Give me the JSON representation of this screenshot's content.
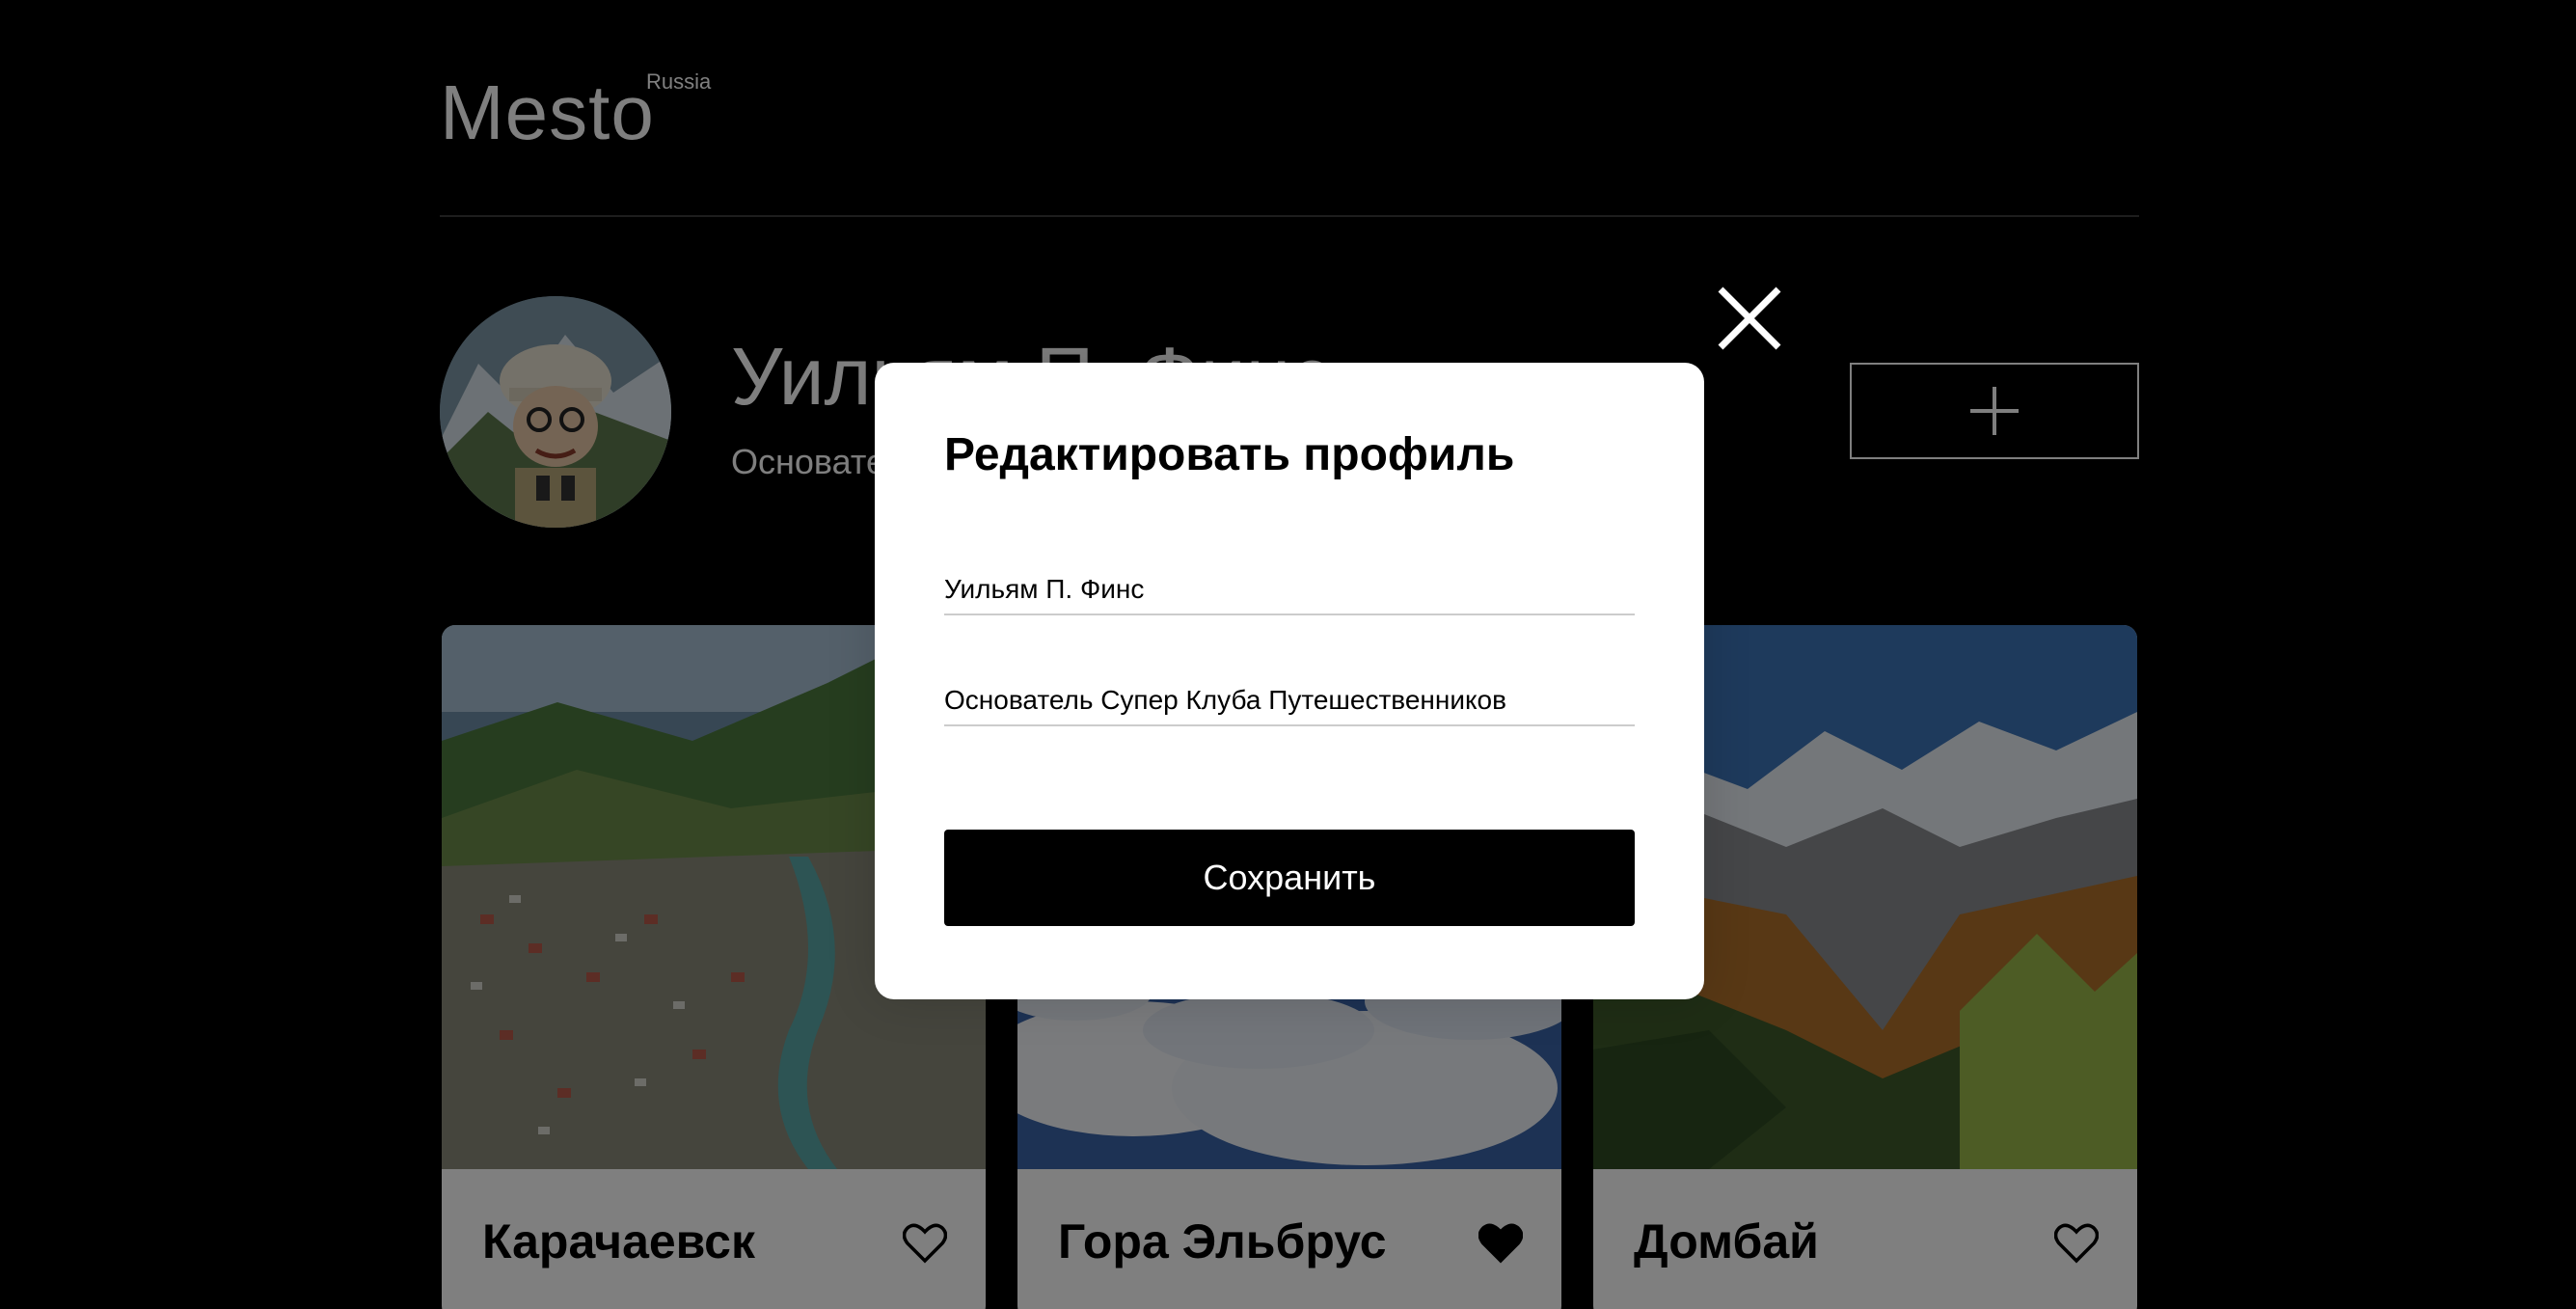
{
  "header": {
    "logo_text": "Mesto",
    "logo_sup": "Russia"
  },
  "profile": {
    "name": "Уильям П. Финс",
    "about": "Основатель Супер Клуба Путешественников",
    "add_button_icon": "plus-icon"
  },
  "cards": [
    {
      "title": "Карачаевск",
      "liked": false,
      "like_icon": "heart-outline-icon"
    },
    {
      "title": "Гора Эльбрус",
      "liked": true,
      "like_icon": "heart-filled-icon"
    },
    {
      "title": "Домбай",
      "liked": false,
      "like_icon": "heart-outline-icon"
    }
  ],
  "popup": {
    "title": "Редактировать профиль",
    "name_value": "Уильям П. Финс",
    "about_value": "Основатель Супер Клуба Путешественников",
    "save_label": "Сохранить",
    "close_icon": "close-icon"
  },
  "colors": {
    "page_bg": "#000000",
    "popup_bg": "#ffffff",
    "button_bg": "#000000",
    "overlay": "rgba(0,0,0,0.5)"
  }
}
